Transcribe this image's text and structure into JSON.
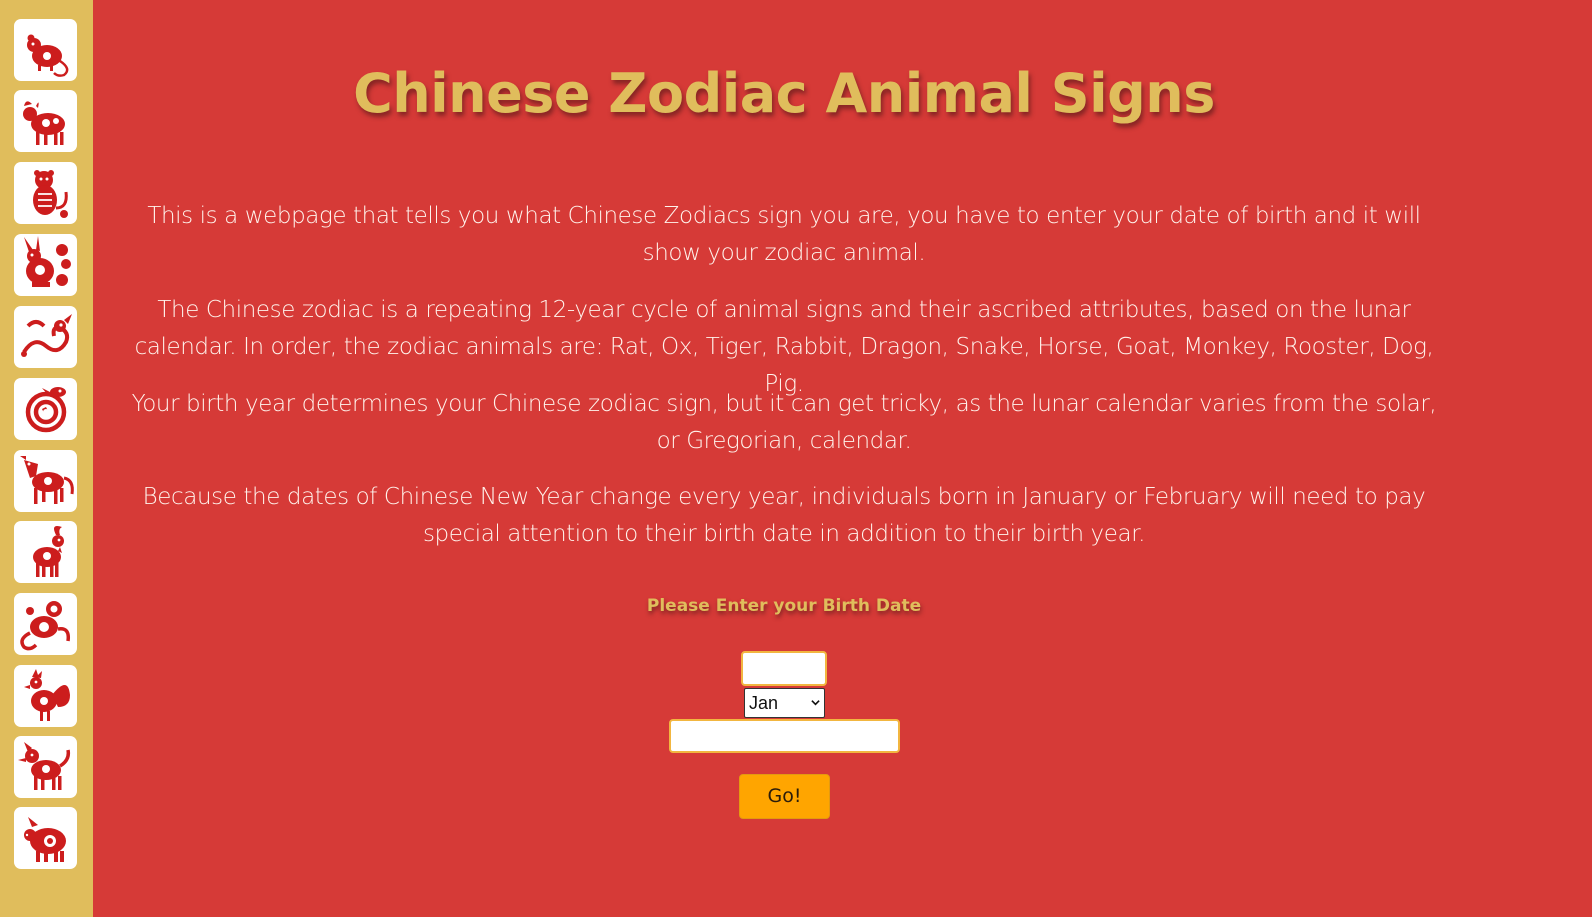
{
  "page": {
    "title": "Chinese Zodiac Animal Signs",
    "paragraphs": [
      "This is a webpage that tells you what Chinese Zodiacs sign you are, you have to enter your date of birth and it will show your zodiac animal.",
      "The Chinese zodiac is a repeating 12-year cycle of animal signs and their ascribed attributes, based on the lunar calendar. In order, the zodiac animals are: Rat, Ox, Tiger, Rabbit, Dragon, Snake, Horse, Goat, Monkey, Rooster, Dog, Pig.",
      "Your birth year determines your Chinese zodiac sign, but it can get tricky, as the lunar calendar varies from the solar, or Gregorian, calendar.",
      "Because the dates of Chinese New Year change every year, individuals born in January or February will need to pay special attention to their birth date in addition to their birth year."
    ]
  },
  "sidebar": {
    "icons": [
      "rat-icon",
      "ox-icon",
      "tiger-icon",
      "rabbit-icon",
      "dragon-icon",
      "snake-icon",
      "horse-icon",
      "goat-icon",
      "monkey-icon",
      "rooster-icon",
      "dog-icon",
      "pig-icon"
    ]
  },
  "form": {
    "prompt": "Please Enter your Birth Date",
    "day_value": "",
    "month_selected": "Jan",
    "year_value": "",
    "submit_label": "Go!"
  },
  "colors": {
    "background": "#d63a37",
    "sidebar": "#e0bd5c",
    "heading": "#e0bd5c",
    "button": "#ffa500",
    "input_border": "#f2b640",
    "papercut": "#cc1d1d"
  }
}
